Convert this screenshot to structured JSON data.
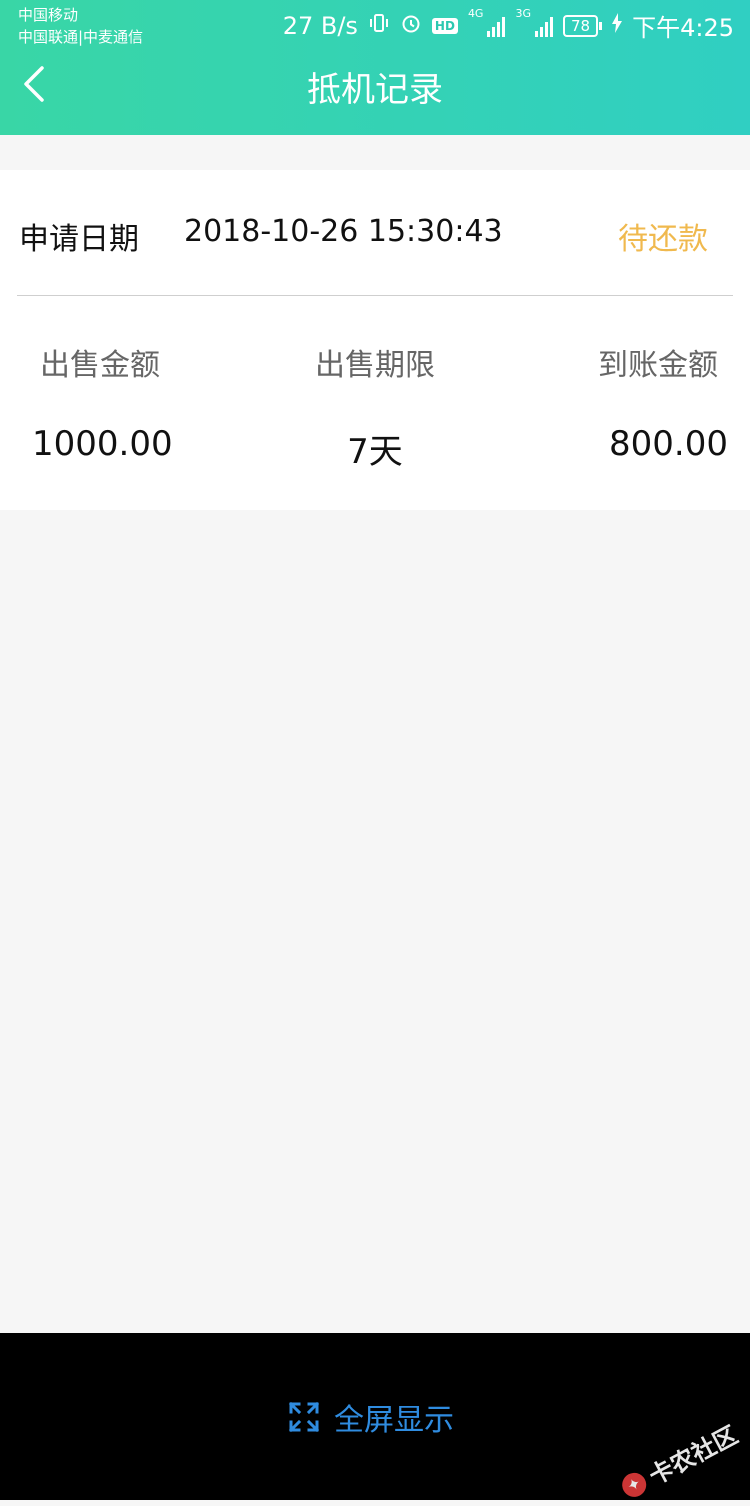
{
  "status_bar": {
    "carrier_1": "中国移动",
    "carrier_2": "中国联通|中麦通信",
    "net_speed": "27 B/s",
    "hd": "HD",
    "net_4g": "4G",
    "net_3g": "3G",
    "battery": "78",
    "time": "下午4:25",
    "icons": [
      "vibrate-icon",
      "alarm-icon",
      "charging-icon"
    ]
  },
  "nav": {
    "title": "抵机记录",
    "back_icon": "chevron-left-icon"
  },
  "record": {
    "apply_label": "申请日期",
    "apply_date": "2018-10-26 15:30:43",
    "status": "待还款",
    "status_color": "#f0b94e",
    "columns": [
      {
        "label": "出售金额",
        "value": "1000.00"
      },
      {
        "label": "出售期限",
        "value": "7天"
      },
      {
        "label": "到账金额",
        "value": "800.00"
      }
    ]
  },
  "bottom": {
    "fullscreen_label": "全屏显示",
    "fullscreen_icon": "expand-icon",
    "watermark": "卡农社区"
  },
  "colors": {
    "header_start": "#39d6a6",
    "header_end": "#30cfc2",
    "accent_blue": "#2f8ce0"
  }
}
